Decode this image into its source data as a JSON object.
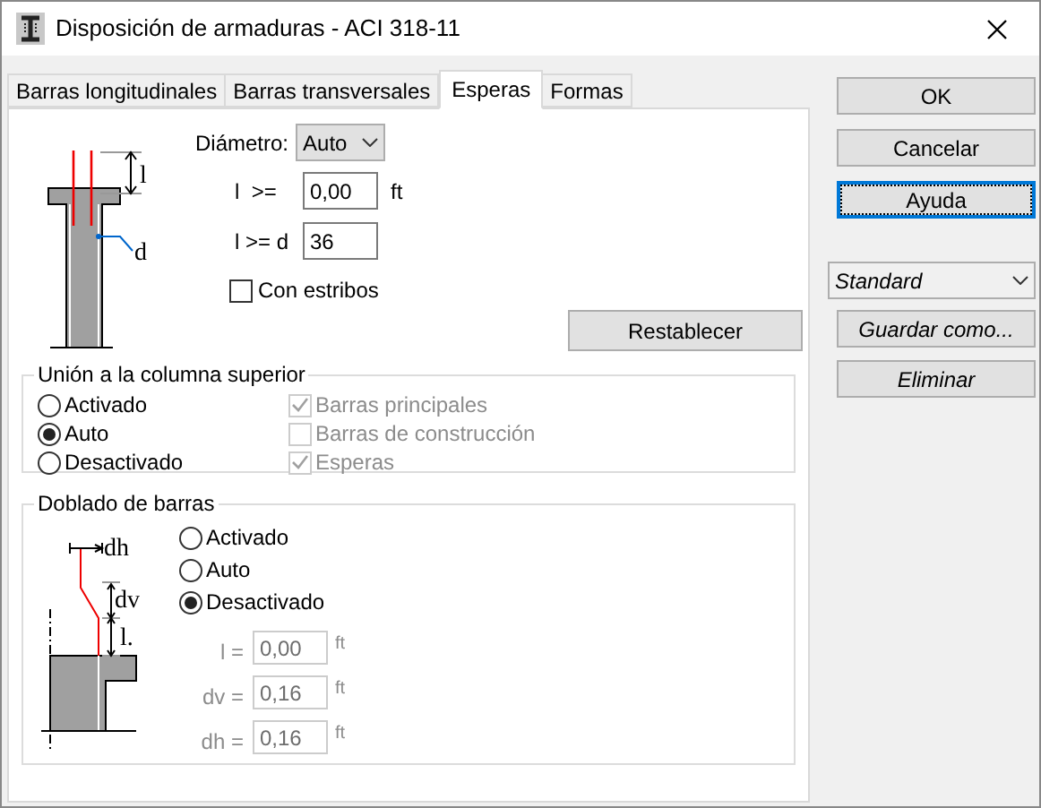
{
  "window": {
    "title": "Disposición de armaduras - ACI 318-11"
  },
  "tabs": [
    {
      "label": "Barras longitudinales",
      "selected": false
    },
    {
      "label": "Barras transversales",
      "selected": false
    },
    {
      "label": "Esperas",
      "selected": true
    },
    {
      "label": "Formas",
      "selected": false
    }
  ],
  "esperas": {
    "diagram_labels": [
      "l",
      "d"
    ],
    "diameter": {
      "label": "Diámetro:",
      "value": "Auto"
    },
    "fields": [
      {
        "label": "l  >=",
        "value": "0,00",
        "unit": "ft"
      },
      {
        "label": "l >= d",
        "value": "36"
      }
    ],
    "checkbox": {
      "label": "Con estribos",
      "checked": false
    },
    "reset_button": "Restablecer"
  },
  "union": {
    "title": "Unión a la columna superior",
    "options": [
      {
        "label": "Activado",
        "selected": false
      },
      {
        "label": "Auto",
        "selected": true
      },
      {
        "label": "Desactivado",
        "selected": false
      }
    ],
    "checks": [
      {
        "label": "Barras principales",
        "checked": true,
        "disabled": true
      },
      {
        "label": "Barras de construcción",
        "checked": false,
        "disabled": true
      },
      {
        "label": "Esperas",
        "checked": true,
        "disabled": true
      }
    ]
  },
  "doblado": {
    "title": "Doblado de barras",
    "diagram_labels": [
      "dh",
      "dv",
      "l."
    ],
    "options": [
      {
        "label": "Activado",
        "selected": false
      },
      {
        "label": "Auto",
        "selected": false
      },
      {
        "label": "Desactivado",
        "selected": true
      }
    ],
    "fields": [
      {
        "label": "l =",
        "value": "0,00",
        "unit": "ft",
        "disabled": true
      },
      {
        "label": "dv =",
        "value": "0,16",
        "unit": "ft",
        "disabled": true
      },
      {
        "label": "dh =",
        "value": "0,16",
        "unit": "ft",
        "disabled": true
      }
    ]
  },
  "buttons": [
    {
      "label": "OK",
      "focused": false
    },
    {
      "label": "Cancelar",
      "focused": false
    },
    {
      "label": "Ayuda",
      "focused": true
    }
  ],
  "preset": {
    "value": "Standard"
  },
  "preset_buttons": [
    "Guardar como...",
    "Eliminar"
  ]
}
